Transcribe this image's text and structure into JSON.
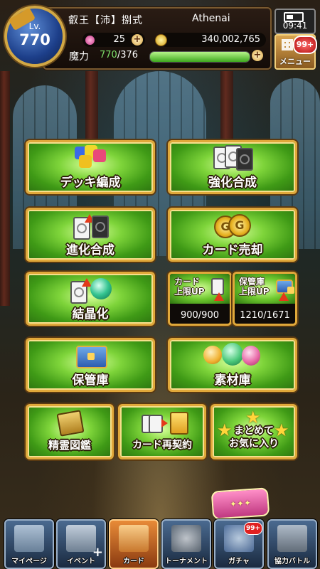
{
  "player": {
    "level_label": "Lv.",
    "level": "770",
    "name": "叡王【沛】捌式",
    "guild": "Athenai",
    "gems": "25",
    "coins": "340,002,765",
    "mana_label": "魔力",
    "mana_current": "770",
    "mana_max": "/376",
    "mana_fill_percent": 100
  },
  "status": {
    "time": "09:41"
  },
  "menu": {
    "label": "メニュー",
    "badge": "99+"
  },
  "buttons": {
    "deck": "デッキ編成",
    "enhance": "強化合成",
    "evolve": "進化合成",
    "sell": "カード売却",
    "crystal": "結晶化",
    "storage": "保管庫",
    "material": "素材庫",
    "encyclopedia": "精霊図鑑",
    "recontract": "カード再契約",
    "favorites_line1": "まとめて",
    "favorites_line2": "お気に入り"
  },
  "capacity": {
    "card_label_1": "カード",
    "card_label_2": "上限UP",
    "card_count": "900/900",
    "storage_label_1": "保管庫",
    "storage_label_2": "上限UP",
    "storage_count": "1210/1671"
  },
  "nav": {
    "items": [
      {
        "label": "マイページ",
        "icon": "house-icon"
      },
      {
        "label": "イベント",
        "icon": "event-icon"
      },
      {
        "label": "カード",
        "icon": "card-icon"
      },
      {
        "label": "トーナメント",
        "icon": "tournament-icon"
      },
      {
        "label": "ガチャ",
        "icon": "gacha-icon",
        "badge": "99+"
      },
      {
        "label": "協力バトル",
        "icon": "coop-battle-icon"
      }
    ],
    "event_plus": "+"
  },
  "colors": {
    "button_green": "#7ed43a",
    "button_border": "#e0a83a",
    "mana_green": "#3ea81e",
    "badge_red": "#e02020"
  }
}
